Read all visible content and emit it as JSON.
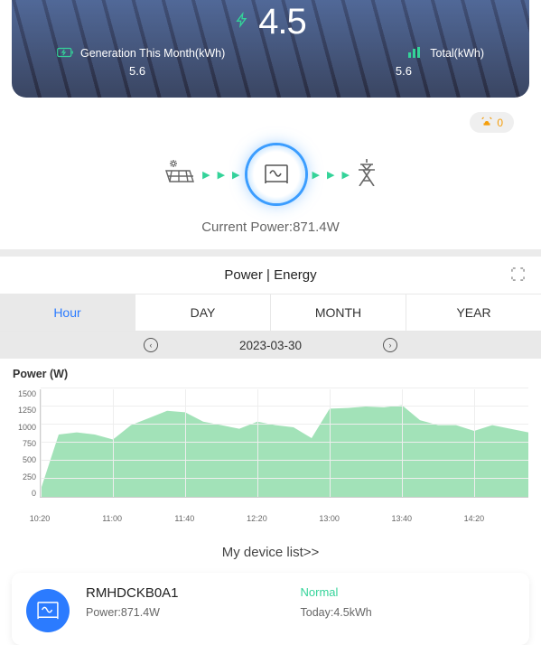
{
  "hero": {
    "main_value": "4.5",
    "gen_label": "Generation This Month(kWh)",
    "gen_value": "5.6",
    "total_label": "Total(kWh)",
    "total_value": "5.6"
  },
  "alarm_count": "0",
  "current_power_label": "Current Power:871.4W",
  "section_title": "Power | Energy",
  "tabs": {
    "hour": "Hour",
    "day": "DAY",
    "month": "MONTH",
    "year": "YEAR"
  },
  "date": "2023-03-30",
  "chart_ylabel": "Power (W)",
  "chart_data": {
    "type": "area",
    "ylabel": "Power (W)",
    "ylim": [
      0,
      1500
    ],
    "yticks": [
      0,
      250,
      500,
      750,
      1000,
      1250,
      1500
    ],
    "xticks": [
      "10:20",
      "11:00",
      "11:40",
      "12:20",
      "13:00",
      "13:40",
      "14:20"
    ],
    "x": [
      "10:20",
      "10:30",
      "10:40",
      "10:50",
      "11:00",
      "11:10",
      "11:20",
      "11:30",
      "11:40",
      "11:50",
      "12:00",
      "12:10",
      "12:20",
      "12:30",
      "12:40",
      "12:50",
      "13:00",
      "13:10",
      "13:20",
      "13:30",
      "13:40",
      "13:50",
      "14:00",
      "14:10",
      "14:20",
      "14:30",
      "14:40",
      "14:50"
    ],
    "values": [
      100,
      870,
      900,
      870,
      800,
      1000,
      1100,
      1200,
      1180,
      1050,
      1000,
      950,
      1050,
      1000,
      970,
      820,
      1230,
      1240,
      1260,
      1250,
      1280,
      1070,
      1000,
      1000,
      920,
      1000,
      950,
      900
    ]
  },
  "devlist_title": "My device list>>",
  "device": {
    "name": "RMHDCKB0A1",
    "status": "Normal",
    "power_label": "Power:871.4W",
    "today_label": "Today:4.5kWh"
  }
}
